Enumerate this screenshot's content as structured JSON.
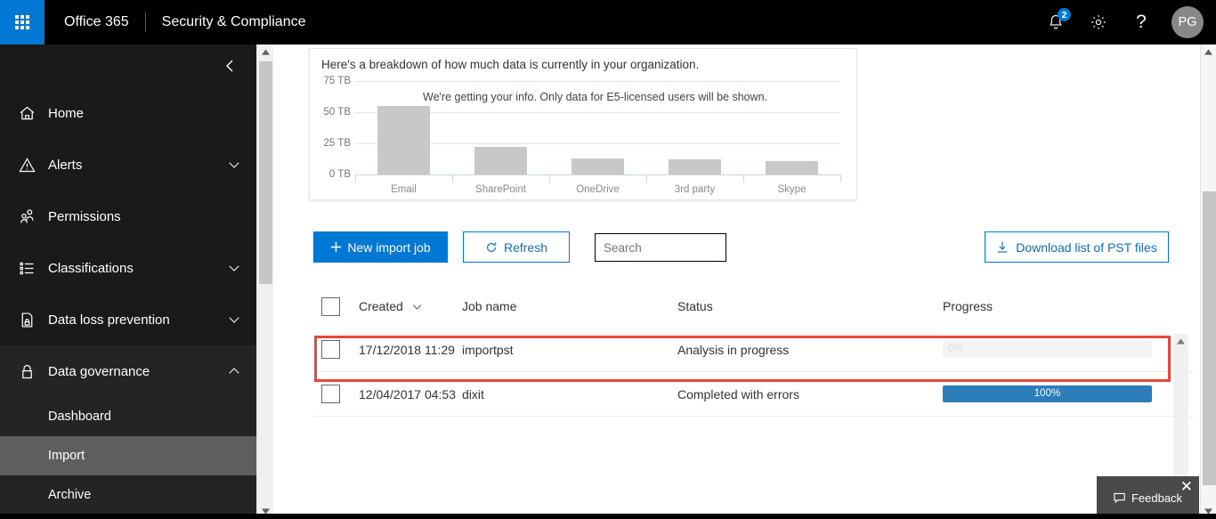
{
  "suite": {
    "waffle_icon": "waffle-icon",
    "brand": "Office 365",
    "app_title": "Security & Compliance",
    "notifications_icon": "bell-icon",
    "notifications_count": "2",
    "settings_icon": "gear-icon",
    "help_icon": "?",
    "avatar_initials": "PG"
  },
  "sidebar": {
    "collapse_icon": "chevron-left-icon",
    "items": [
      {
        "label": "Home",
        "icon": "home-icon",
        "chevron": ""
      },
      {
        "label": "Alerts",
        "icon": "alert-triangle-icon",
        "chevron": "down"
      },
      {
        "label": "Permissions",
        "icon": "people-icon",
        "chevron": ""
      },
      {
        "label": "Classifications",
        "icon": "list-icon",
        "chevron": "down"
      },
      {
        "label": "Data loss prevention",
        "icon": "document-lock-icon",
        "chevron": "down"
      },
      {
        "label": "Data governance",
        "icon": "lock-icon",
        "chevron": "up"
      }
    ],
    "subitems": [
      {
        "label": "Dashboard",
        "selected": false
      },
      {
        "label": "Import",
        "selected": true
      },
      {
        "label": "Archive",
        "selected": false
      }
    ]
  },
  "chart_data": {
    "type": "bar",
    "title": "Here's a breakdown of how much data is currently in your organization.",
    "annotation": "We're getting your info. Only data for E5-licensed users will be shown.",
    "categories": [
      "Email",
      "SharePoint",
      "OneDrive",
      "3rd party",
      "Skype"
    ],
    "values": [
      55,
      22,
      13,
      12,
      11
    ],
    "xlabel": "",
    "ylabel": "",
    "ylim": [
      0,
      75
    ],
    "yticks": [
      "0 TB",
      "25 TB",
      "50 TB",
      "75 TB"
    ],
    "ytick_values": [
      0,
      25,
      50,
      75
    ],
    "unit": "TB",
    "grid": true,
    "legend": "none",
    "bar_color": "#c8c8c8"
  },
  "toolbar": {
    "new_import_job_label": "New import job",
    "new_import_job_icon": "plus-icon",
    "refresh_label": "Refresh",
    "refresh_icon": "refresh-icon",
    "search_placeholder": "Search",
    "search_value": "",
    "search_icon": "search-icon",
    "download_label": "Download list of PST files",
    "download_icon": "download-icon"
  },
  "table": {
    "columns": [
      "Created",
      "Job name",
      "Status",
      "Progress"
    ],
    "sort_icon": "chevron-down-icon",
    "rows": [
      {
        "created": "17/12/2018 11:29",
        "job_name": "importpst",
        "status": "Analysis in progress",
        "progress_label": "0%",
        "progress_value": 0,
        "highlighted": true
      },
      {
        "created": "12/04/2017 04:53",
        "job_name": "dixit",
        "status": "Completed with errors",
        "progress_label": "100%",
        "progress_value": 100,
        "highlighted": false
      }
    ]
  },
  "feedback": {
    "label": "Feedback",
    "icon": "comment-icon",
    "close_icon": "close-icon"
  },
  "colors": {
    "accent": "#0078d4",
    "highlight": "#e8473f",
    "progress_fill": "#2b7cb9",
    "nav_bg": "#1b1a19"
  }
}
